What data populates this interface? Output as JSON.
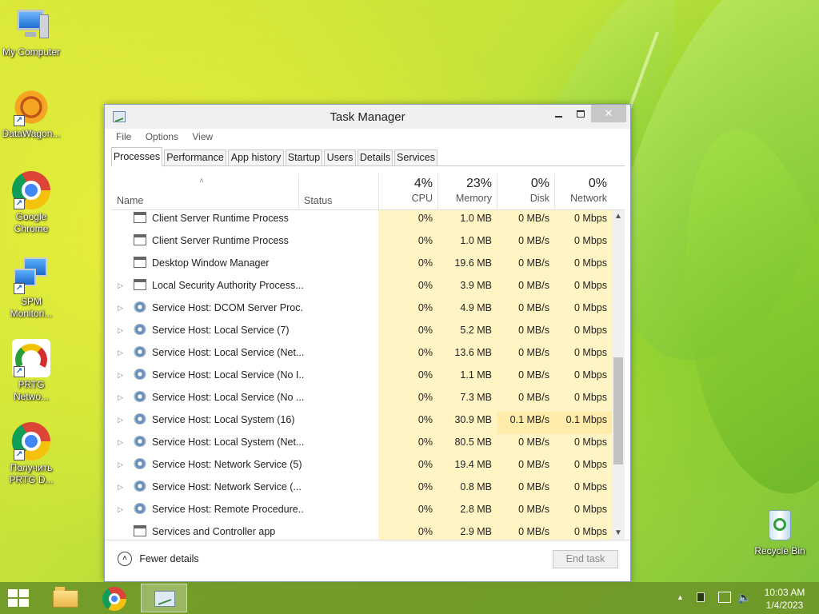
{
  "desktop": {
    "icons": [
      {
        "label": "My Computer"
      },
      {
        "label": "DataWagon..."
      },
      {
        "label": "Google Chrome"
      },
      {
        "label": "SPM Monitori..."
      },
      {
        "label": "PRTG Netwo..."
      },
      {
        "label": "Получить PRTG D..."
      },
      {
        "label": "Recycle Bin"
      }
    ]
  },
  "window": {
    "title": "Task Manager",
    "menu": [
      "File",
      "Options",
      "View"
    ],
    "tabs": [
      "Processes",
      "Performance",
      "App history",
      "Startup",
      "Users",
      "Details",
      "Services"
    ],
    "active_tab": "Processes",
    "columns": {
      "name": "Name",
      "status": "Status",
      "cpu": {
        "pct": "4%",
        "label": "CPU"
      },
      "memory": {
        "pct": "23%",
        "label": "Memory"
      },
      "disk": {
        "pct": "0%",
        "label": "Disk"
      },
      "network": {
        "pct": "0%",
        "label": "Network"
      }
    },
    "rows": [
      {
        "name": "Client Server Runtime Process",
        "cpu": "0%",
        "mem": "1.0 MB",
        "disk": "0 MB/s",
        "net": "0 Mbps",
        "icon": "window-icon",
        "expand": ""
      },
      {
        "name": "Client Server Runtime Process",
        "cpu": "0%",
        "mem": "1.0 MB",
        "disk": "0 MB/s",
        "net": "0 Mbps",
        "icon": "window-icon",
        "expand": ""
      },
      {
        "name": "Desktop Window Manager",
        "cpu": "0%",
        "mem": "19.6 MB",
        "disk": "0 MB/s",
        "net": "0 Mbps",
        "icon": "window-icon",
        "expand": ""
      },
      {
        "name": "Local Security Authority Process...",
        "cpu": "0%",
        "mem": "3.9 MB",
        "disk": "0 MB/s",
        "net": "0 Mbps",
        "icon": "window-icon",
        "expand": "▷"
      },
      {
        "name": "Service Host: DCOM Server Proc...",
        "cpu": "0%",
        "mem": "4.9 MB",
        "disk": "0 MB/s",
        "net": "0 Mbps",
        "icon": "gear-icon",
        "expand": "▷"
      },
      {
        "name": "Service Host: Local Service (7)",
        "cpu": "0%",
        "mem": "5.2 MB",
        "disk": "0 MB/s",
        "net": "0 Mbps",
        "icon": "gear-icon",
        "expand": "▷"
      },
      {
        "name": "Service Host: Local Service (Net...",
        "cpu": "0%",
        "mem": "13.6 MB",
        "disk": "0 MB/s",
        "net": "0 Mbps",
        "icon": "gear-icon",
        "expand": "▷"
      },
      {
        "name": "Service Host: Local Service (No I...",
        "cpu": "0%",
        "mem": "1.1 MB",
        "disk": "0 MB/s",
        "net": "0 Mbps",
        "icon": "gear-icon",
        "expand": "▷"
      },
      {
        "name": "Service Host: Local Service (No ...",
        "cpu": "0%",
        "mem": "7.3 MB",
        "disk": "0 MB/s",
        "net": "0 Mbps",
        "icon": "gear-icon",
        "expand": "▷"
      },
      {
        "name": "Service Host: Local System (16)",
        "cpu": "0%",
        "mem": "30.9 MB",
        "disk": "0.1 MB/s",
        "net": "0.1 Mbps",
        "icon": "gear-icon",
        "expand": "▷"
      },
      {
        "name": "Service Host: Local System (Net...",
        "cpu": "0%",
        "mem": "80.5 MB",
        "disk": "0 MB/s",
        "net": "0 Mbps",
        "icon": "gear-icon",
        "expand": "▷"
      },
      {
        "name": "Service Host: Network Service (5)",
        "cpu": "0%",
        "mem": "19.4 MB",
        "disk": "0 MB/s",
        "net": "0 Mbps",
        "icon": "gear-icon",
        "expand": "▷"
      },
      {
        "name": "Service Host: Network Service (...",
        "cpu": "0%",
        "mem": "0.8 MB",
        "disk": "0 MB/s",
        "net": "0 Mbps",
        "icon": "gear-icon",
        "expand": "▷"
      },
      {
        "name": "Service Host: Remote Procedure...",
        "cpu": "0%",
        "mem": "2.8 MB",
        "disk": "0 MB/s",
        "net": "0 Mbps",
        "icon": "gear-icon",
        "expand": "▷"
      },
      {
        "name": "Services and Controller app",
        "cpu": "0%",
        "mem": "2.9 MB",
        "disk": "0 MB/s",
        "net": "0 Mbps",
        "icon": "window-icon",
        "expand": ""
      }
    ],
    "footer": {
      "fewer_details": "Fewer details",
      "end_task": "End task"
    }
  },
  "taskbar": {
    "time": "10:03 AM",
    "date": "1/4/2023"
  }
}
